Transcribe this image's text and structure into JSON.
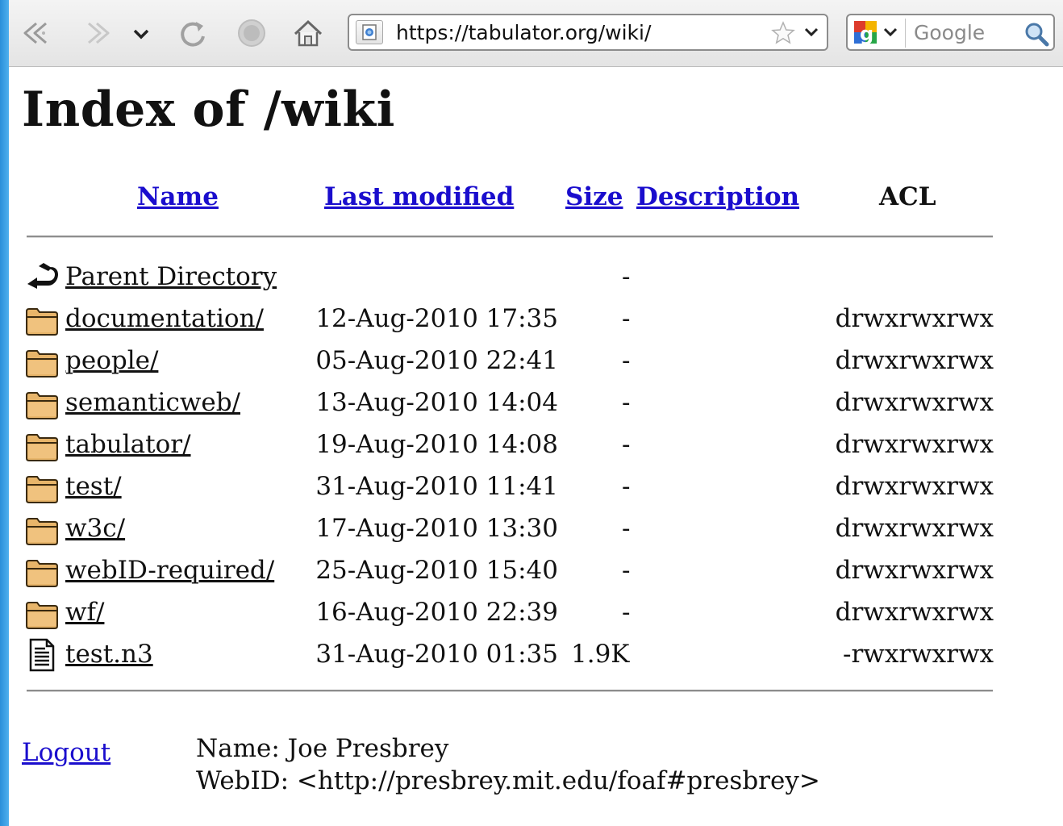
{
  "browser": {
    "url": "https://tabulator.org/wiki/",
    "search_placeholder": "Google",
    "icons": [
      "back-icon",
      "forward-icon",
      "history-dropdown-icon",
      "reload-icon",
      "stop-icon",
      "home-icon",
      "site-identity-icon",
      "bookmark-star-icon",
      "url-dropdown-icon",
      "search-engine-icon",
      "search-go-icon"
    ]
  },
  "page": {
    "title": "Index of /wiki",
    "headers": {
      "name": "Name",
      "last_modified": "Last modified",
      "size": "Size",
      "description": "Description",
      "acl": "ACL"
    },
    "rows": [
      {
        "icon": "parent-directory-icon",
        "name": "Parent Directory",
        "date": "",
        "size": "-",
        "acl": ""
      },
      {
        "icon": "folder-icon",
        "name": "documentation/",
        "date": "12-Aug-2010 17:35",
        "size": "-",
        "acl": "drwxrwxrwx"
      },
      {
        "icon": "folder-icon",
        "name": "people/",
        "date": "05-Aug-2010 22:41",
        "size": "-",
        "acl": "drwxrwxrwx"
      },
      {
        "icon": "folder-icon",
        "name": "semanticweb/",
        "date": "13-Aug-2010 14:04",
        "size": "-",
        "acl": "drwxrwxrwx"
      },
      {
        "icon": "folder-icon",
        "name": "tabulator/",
        "date": "19-Aug-2010 14:08",
        "size": "-",
        "acl": "drwxrwxrwx"
      },
      {
        "icon": "folder-icon",
        "name": "test/",
        "date": "31-Aug-2010 11:41",
        "size": "-",
        "acl": "drwxrwxrwx"
      },
      {
        "icon": "folder-icon",
        "name": "w3c/",
        "date": "17-Aug-2010 13:30",
        "size": "-",
        "acl": "drwxrwxrwx"
      },
      {
        "icon": "folder-icon",
        "name": "webID-required/",
        "date": "25-Aug-2010 15:40",
        "size": "-",
        "acl": "drwxrwxrwx"
      },
      {
        "icon": "folder-icon",
        "name": "wf/",
        "date": "16-Aug-2010 22:39",
        "size": "-",
        "acl": "drwxrwxrwx"
      },
      {
        "icon": "text-file-icon",
        "name": "test.n3",
        "date": "31-Aug-2010 01:35",
        "size": "1.9K",
        "acl": "-rwxrwxrwx"
      }
    ],
    "footer": {
      "logout": "Logout",
      "name_line": "Name: Joe Presbrey",
      "webid_line": "WebID: <http://presbrey.mit.edu/foaf#presbrey>"
    }
  },
  "colors": {
    "link": "#1a0dcd",
    "text": "#111111",
    "toolbar_bg": "#ececec",
    "window_edge": "#2a8fd9",
    "folder": "#e8b56a"
  }
}
